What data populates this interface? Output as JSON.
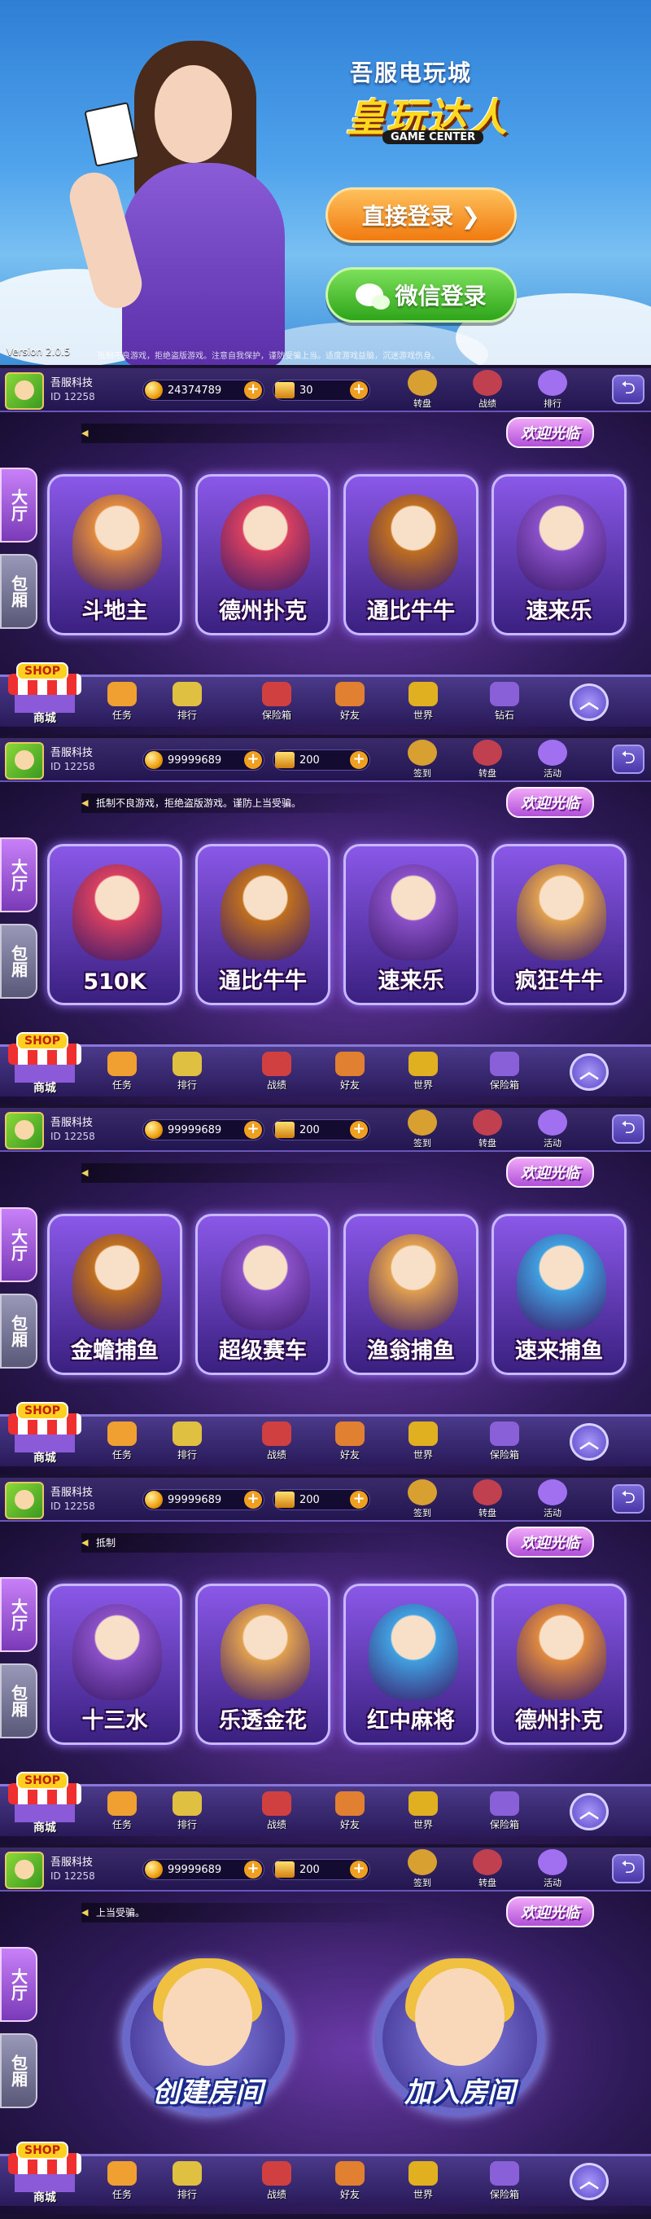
{
  "login": {
    "logo_top": "吾服电玩城",
    "logo_main": "皇玩达人",
    "logo_sub": "GAME CENTER",
    "btn_direct": "直接登录 ❯",
    "btn_wechat": "微信登录",
    "version": "Version 2.0.5",
    "disclaimer": "抵制不良游戏，拒绝盗版游戏。注意自我保护，谨防受骗上当。适度游戏益脑，沉迷游戏伤身。"
  },
  "colors": {
    "accent_purple": "#6a3aa8",
    "gold": "#ffd820",
    "green": "#2ea51a",
    "orange": "#f07a10"
  },
  "screens": [
    {
      "user": {
        "name": "吾服科技",
        "id": "ID 12258"
      },
      "gold": "24374789",
      "cards": "30",
      "top_icons": [
        "转盘",
        "战绩",
        "排行"
      ],
      "welcome": "欢迎光临",
      "notice": "",
      "side": {
        "hall": "大厅",
        "room": "包厢"
      },
      "games": [
        "斗地主",
        "德州扑克",
        "通比牛牛",
        "速来乐"
      ],
      "shop": {
        "sign": "SHOP",
        "label": "商城"
      },
      "bottom_icons": [
        "任务",
        "排行",
        "保险箱",
        "好友",
        "世界",
        "钻石"
      ]
    },
    {
      "user": {
        "name": "吾服科技",
        "id": "ID 12258"
      },
      "gold": "99999689",
      "cards": "200",
      "top_icons": [
        "签到",
        "转盘",
        "活动"
      ],
      "welcome": "欢迎光临",
      "notice": "抵制不良游戏，拒绝盗版游戏。谨防上当受骗。",
      "side": {
        "hall": "大厅",
        "room": "包厢"
      },
      "games": [
        "510K",
        "通比牛牛",
        "速来乐",
        "疯狂牛牛"
      ],
      "shop": {
        "sign": "SHOP",
        "label": "商城"
      },
      "bottom_icons": [
        "任务",
        "排行",
        "战绩",
        "好友",
        "世界",
        "保险箱"
      ]
    },
    {
      "user": {
        "name": "吾服科技",
        "id": "ID 12258"
      },
      "gold": "99999689",
      "cards": "200",
      "top_icons": [
        "签到",
        "转盘",
        "活动"
      ],
      "welcome": "欢迎光临",
      "notice": "",
      "side": {
        "hall": "大厅",
        "room": "包厢"
      },
      "games": [
        "金蟾捕鱼",
        "超级赛车",
        "渔翁捕鱼",
        "速来捕鱼"
      ],
      "shop": {
        "sign": "SHOP",
        "label": "商城"
      },
      "bottom_icons": [
        "任务",
        "排行",
        "战绩",
        "好友",
        "世界",
        "保险箱"
      ]
    },
    {
      "user": {
        "name": "吾服科技",
        "id": "ID 12258"
      },
      "gold": "99999689",
      "cards": "200",
      "top_icons": [
        "签到",
        "转盘",
        "活动"
      ],
      "welcome": "欢迎光临",
      "notice": "抵制",
      "side": {
        "hall": "大厅",
        "room": "包厢"
      },
      "games": [
        "十三水",
        "乐透金花",
        "红中麻将",
        "德州扑克"
      ],
      "shop": {
        "sign": "SHOP",
        "label": "商城"
      },
      "bottom_icons": [
        "任务",
        "排行",
        "战绩",
        "好友",
        "世界",
        "保险箱"
      ]
    },
    {
      "user": {
        "name": "吾服科技",
        "id": "ID 12258"
      },
      "gold": "99999689",
      "cards": "200",
      "top_icons": [
        "签到",
        "转盘",
        "活动"
      ],
      "welcome": "欢迎光临",
      "notice": "上当受骗。",
      "side": {
        "hall": "大厅",
        "room": "包厢"
      },
      "rooms": [
        "创建房间",
        "加入房间"
      ],
      "shop": {
        "sign": "SHOP",
        "label": "商城"
      },
      "bottom_icons": [
        "任务",
        "排行",
        "战绩",
        "好友",
        "世界",
        "保险箱"
      ]
    }
  ]
}
